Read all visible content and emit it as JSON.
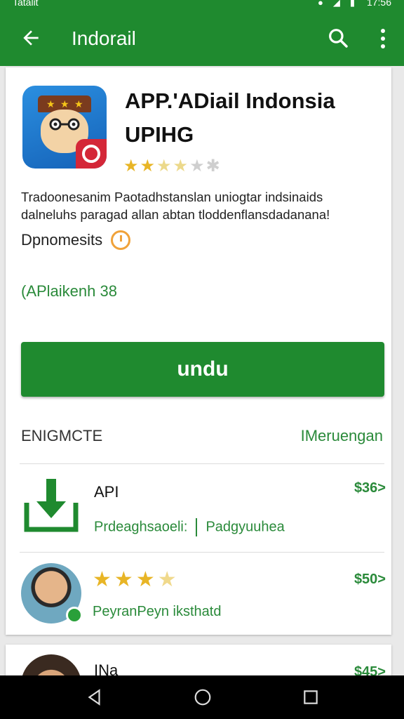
{
  "status_bar": {
    "left_text": "Tatalit",
    "time": "17:56"
  },
  "app_bar": {
    "title": "Indorail"
  },
  "app": {
    "name": "APP.'ADiail Indonsia UPIHG",
    "rating": 2.5,
    "description": "Tradoonesanim Paotadhstanslan uniogtar indsinaids dalneluhs paragad allan abtan tloddenflansdadanana!",
    "developer": "Dpnomesits",
    "meta": "(APlaikenh 38"
  },
  "install_button": {
    "label": "undu"
  },
  "section": {
    "heading": "ENIGMCTE",
    "link": "IMeruengan"
  },
  "list": [
    {
      "title": "API",
      "sub_a": "Prdeaghsaoeli:",
      "sub_b": "Padgyuuhea",
      "price": "$36>"
    },
    {
      "stars": 4,
      "sub": "PeyranPeyn iksthatd",
      "price": "$50>"
    },
    {
      "title": "INa",
      "price": "$45>"
    }
  ],
  "colors": {
    "primary": "#1f8a2f",
    "accent_star": "#e8b526"
  }
}
